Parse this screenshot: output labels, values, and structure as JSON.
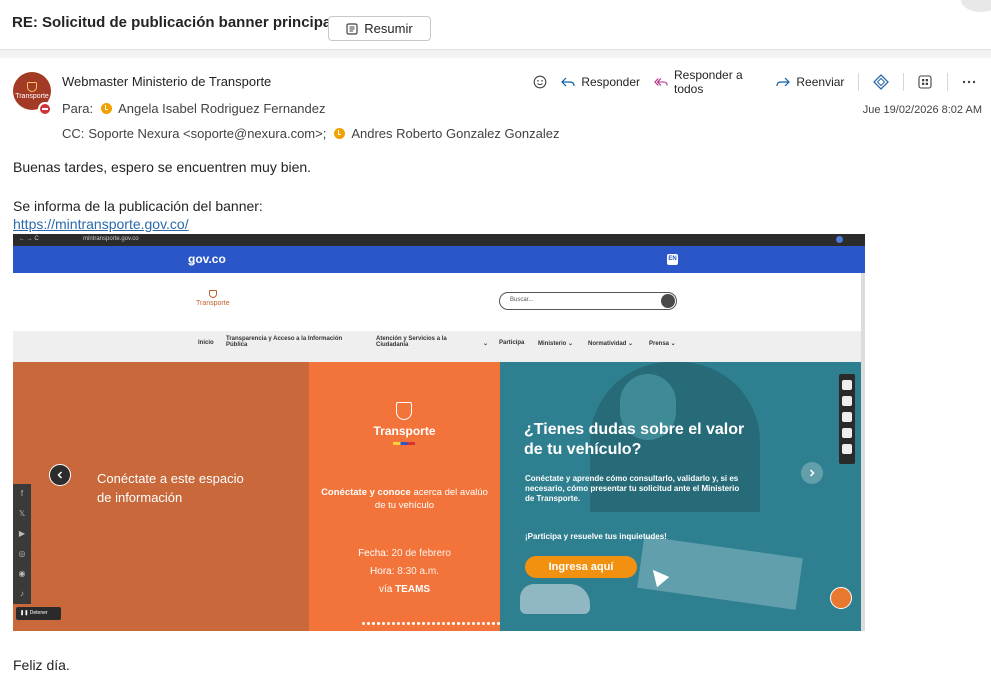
{
  "subject": "RE: Solicitud de publicación banner principal",
  "summarize_label": "Resumir",
  "sender": {
    "name": "Webmaster Ministerio de Transporte",
    "avatar_text": "Transporte"
  },
  "to": {
    "label": "Para:",
    "recipient": "Angela Isabel Rodriguez Fernandez"
  },
  "cc": {
    "label": "CC:",
    "recipient1": "Soporte Nexura <soporte@nexura.com>;",
    "recipient2": "Andres Roberto Gonzalez Gonzalez"
  },
  "actions": {
    "reply": "Responder",
    "reply_all": "Responder a todos",
    "forward": "Reenviar"
  },
  "date": "Jue 19/02/2026 8:02 AM",
  "body": {
    "greeting": "Buenas tardes, espero se encuentren muy bien.",
    "info": "Se informa de la publicación del banner:",
    "link": "https://mintransporte.gov.co/",
    "closing": "Feliz día."
  },
  "banner": {
    "url": "mintransporte.gov.co",
    "gov_logo": "ǥov.co",
    "lang": "EN",
    "logo_text": "Transporte",
    "search_placeholder": "Buscar...",
    "nav": {
      "inicio": "Inicio",
      "transparencia": "Transparencia y Acceso a la Información Pública",
      "atencion": "Atención y Servicios a la Ciudadanía",
      "participa": "Participa",
      "ministerio": "Ministerio ⌄",
      "normatividad": "Normatividad ⌄",
      "prensa": "Prensa ⌄"
    },
    "left_text": "Conéctate a este espacio de información",
    "stop_label": "Detener",
    "mid_title": "Transporte",
    "mid_connect_bold": "Conéctate y conoce",
    "mid_connect_rest": " acerca del avalúo de tu vehículo",
    "mid_fecha_label": "Fecha:",
    "mid_fecha": " 20 de febrero",
    "mid_hora_label": "Hora:",
    "mid_hora": " 8:30 a.m.",
    "mid_via": "vía ",
    "mid_teams": "TEAMS",
    "right_question": "¿Tienes dudas sobre el valor de tu vehículo?",
    "right_desc": "Conéctate y aprende cómo consultarlo, validarlo y, si es necesario, cómo presentar tu solicitud ante el Ministerio de Transporte.",
    "right_participa": "¡Participa y resuelve tus inquietudes!",
    "right_cta": "Ingresa aquí"
  },
  "colors": {
    "link": "#2b6aab",
    "gov_blue": "#2a56c8",
    "banner_left": "#c8683b",
    "banner_mid": "#f2743a",
    "banner_right": "#2e7f8f",
    "cta": "#f29010"
  }
}
